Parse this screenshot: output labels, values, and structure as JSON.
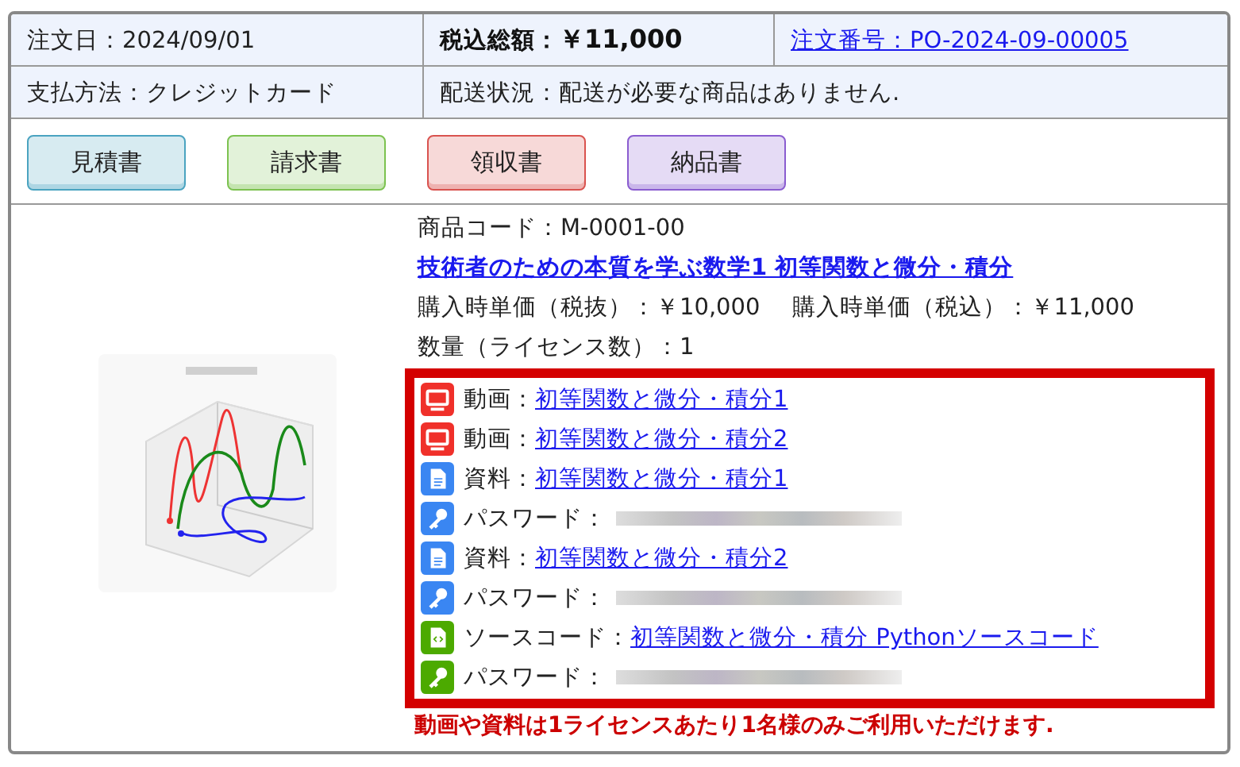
{
  "order": {
    "date": "注文日：2024/09/01",
    "total_label": "税込総額：",
    "total": "￥11,000",
    "number_link": "注文番号：PO-2024-09-00005",
    "payment": "支払方法：クレジットカード",
    "shipping": "配送状況：配送が必要な商品はありません."
  },
  "buttons": [
    {
      "label": "見積書",
      "color": "#4aa3c0"
    },
    {
      "label": "請求書",
      "color": "#7cc250"
    },
    {
      "label": "領収書",
      "color": "#d9534f"
    },
    {
      "label": "納品書",
      "color": "#8a5cd0"
    }
  ],
  "product": {
    "code": "商品コード：M-0001-00",
    "title": "技術者のための本質を学ぶ数学1 初等関数と微分・積分",
    "price_ex": "購入時単価（税抜）：￥10,000",
    "price_in": "購入時単価（税込）：￥11,000",
    "quantity": "数量（ライセンス数）：1"
  },
  "downloads": [
    {
      "kind": "video",
      "color": "#f0302a",
      "label": "動画：",
      "link": "初等関数と微分・積分1"
    },
    {
      "kind": "video",
      "color": "#f0302a",
      "label": "動画：",
      "link": "初等関数と微分・積分2"
    },
    {
      "kind": "document",
      "color": "#3a86f2",
      "label": "資料：",
      "link": "初等関数と微分・積分1"
    },
    {
      "kind": "password",
      "color": "#3a86f2",
      "label": "パスワード：",
      "masked": true
    },
    {
      "kind": "document",
      "color": "#3a86f2",
      "label": "資料：",
      "link": "初等関数と微分・積分2"
    },
    {
      "kind": "password",
      "color": "#3a86f2",
      "label": "パスワード：",
      "masked": true
    },
    {
      "kind": "source",
      "color": "#4caa00",
      "label": "ソースコード：",
      "link": "初等関数と微分・積分 Pythonソースコード"
    },
    {
      "kind": "password",
      "color": "#4caa00",
      "label": "パスワード：",
      "masked": true
    }
  ],
  "note": "動画や資料は1ライセンスあたり1名様のみご利用いただけます."
}
